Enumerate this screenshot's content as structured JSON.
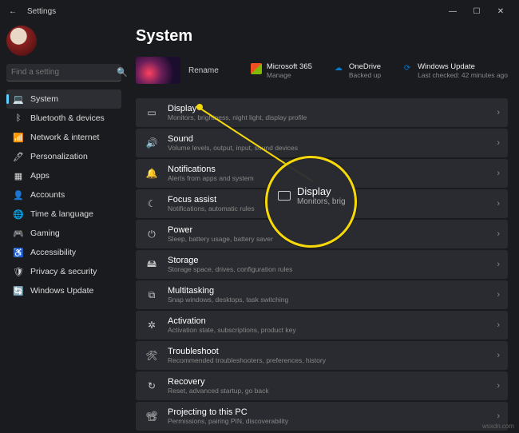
{
  "titlebar": {
    "title": "Settings"
  },
  "search": {
    "placeholder": "Find a setting"
  },
  "sidebar": {
    "items": [
      {
        "label": "System",
        "icon": "💻"
      },
      {
        "label": "Bluetooth & devices",
        "icon": "ᛒ"
      },
      {
        "label": "Network & internet",
        "icon": "📶"
      },
      {
        "label": "Personalization",
        "icon": "🖊"
      },
      {
        "label": "Apps",
        "icon": "▦"
      },
      {
        "label": "Accounts",
        "icon": "👤"
      },
      {
        "label": "Time & language",
        "icon": "🌐"
      },
      {
        "label": "Gaming",
        "icon": "🎮"
      },
      {
        "label": "Accessibility",
        "icon": "♿"
      },
      {
        "label": "Privacy & security",
        "icon": "🛡"
      },
      {
        "label": "Windows Update",
        "icon": "🔄"
      }
    ]
  },
  "page": {
    "title": "System",
    "rename": "Rename"
  },
  "hero": {
    "ms365": {
      "title": "Microsoft 365",
      "sub": "Manage"
    },
    "onedrive": {
      "title": "OneDrive",
      "sub": "Backed up"
    },
    "update": {
      "title": "Windows Update",
      "sub": "Last checked: 42 minutes ago"
    }
  },
  "cards": [
    {
      "icon": "▭",
      "title": "Display",
      "sub": "Monitors, brightness, night light, display profile"
    },
    {
      "icon": "🔊",
      "title": "Sound",
      "sub": "Volume levels, output, input, sound devices"
    },
    {
      "icon": "🔔",
      "title": "Notifications",
      "sub": "Alerts from apps and system"
    },
    {
      "icon": "☾",
      "title": "Focus assist",
      "sub": "Notifications, automatic rules"
    },
    {
      "icon": "⏻",
      "title": "Power",
      "sub": "Sleep, battery usage, battery saver"
    },
    {
      "icon": "🖴",
      "title": "Storage",
      "sub": "Storage space, drives, configuration rules"
    },
    {
      "icon": "⧉",
      "title": "Multitasking",
      "sub": "Snap windows, desktops, task switching"
    },
    {
      "icon": "✲",
      "title": "Activation",
      "sub": "Activation state, subscriptions, product key"
    },
    {
      "icon": "🛠",
      "title": "Troubleshoot",
      "sub": "Recommended troubleshooters, preferences, history"
    },
    {
      "icon": "↻",
      "title": "Recovery",
      "sub": "Reset, advanced startup, go back"
    },
    {
      "icon": "📽",
      "title": "Projecting to this PC",
      "sub": "Permissions, pairing PIN, discoverability"
    }
  ],
  "callout": {
    "title": "Display",
    "sub": "Monitors, brig"
  },
  "watermark": "wsxdn.com"
}
